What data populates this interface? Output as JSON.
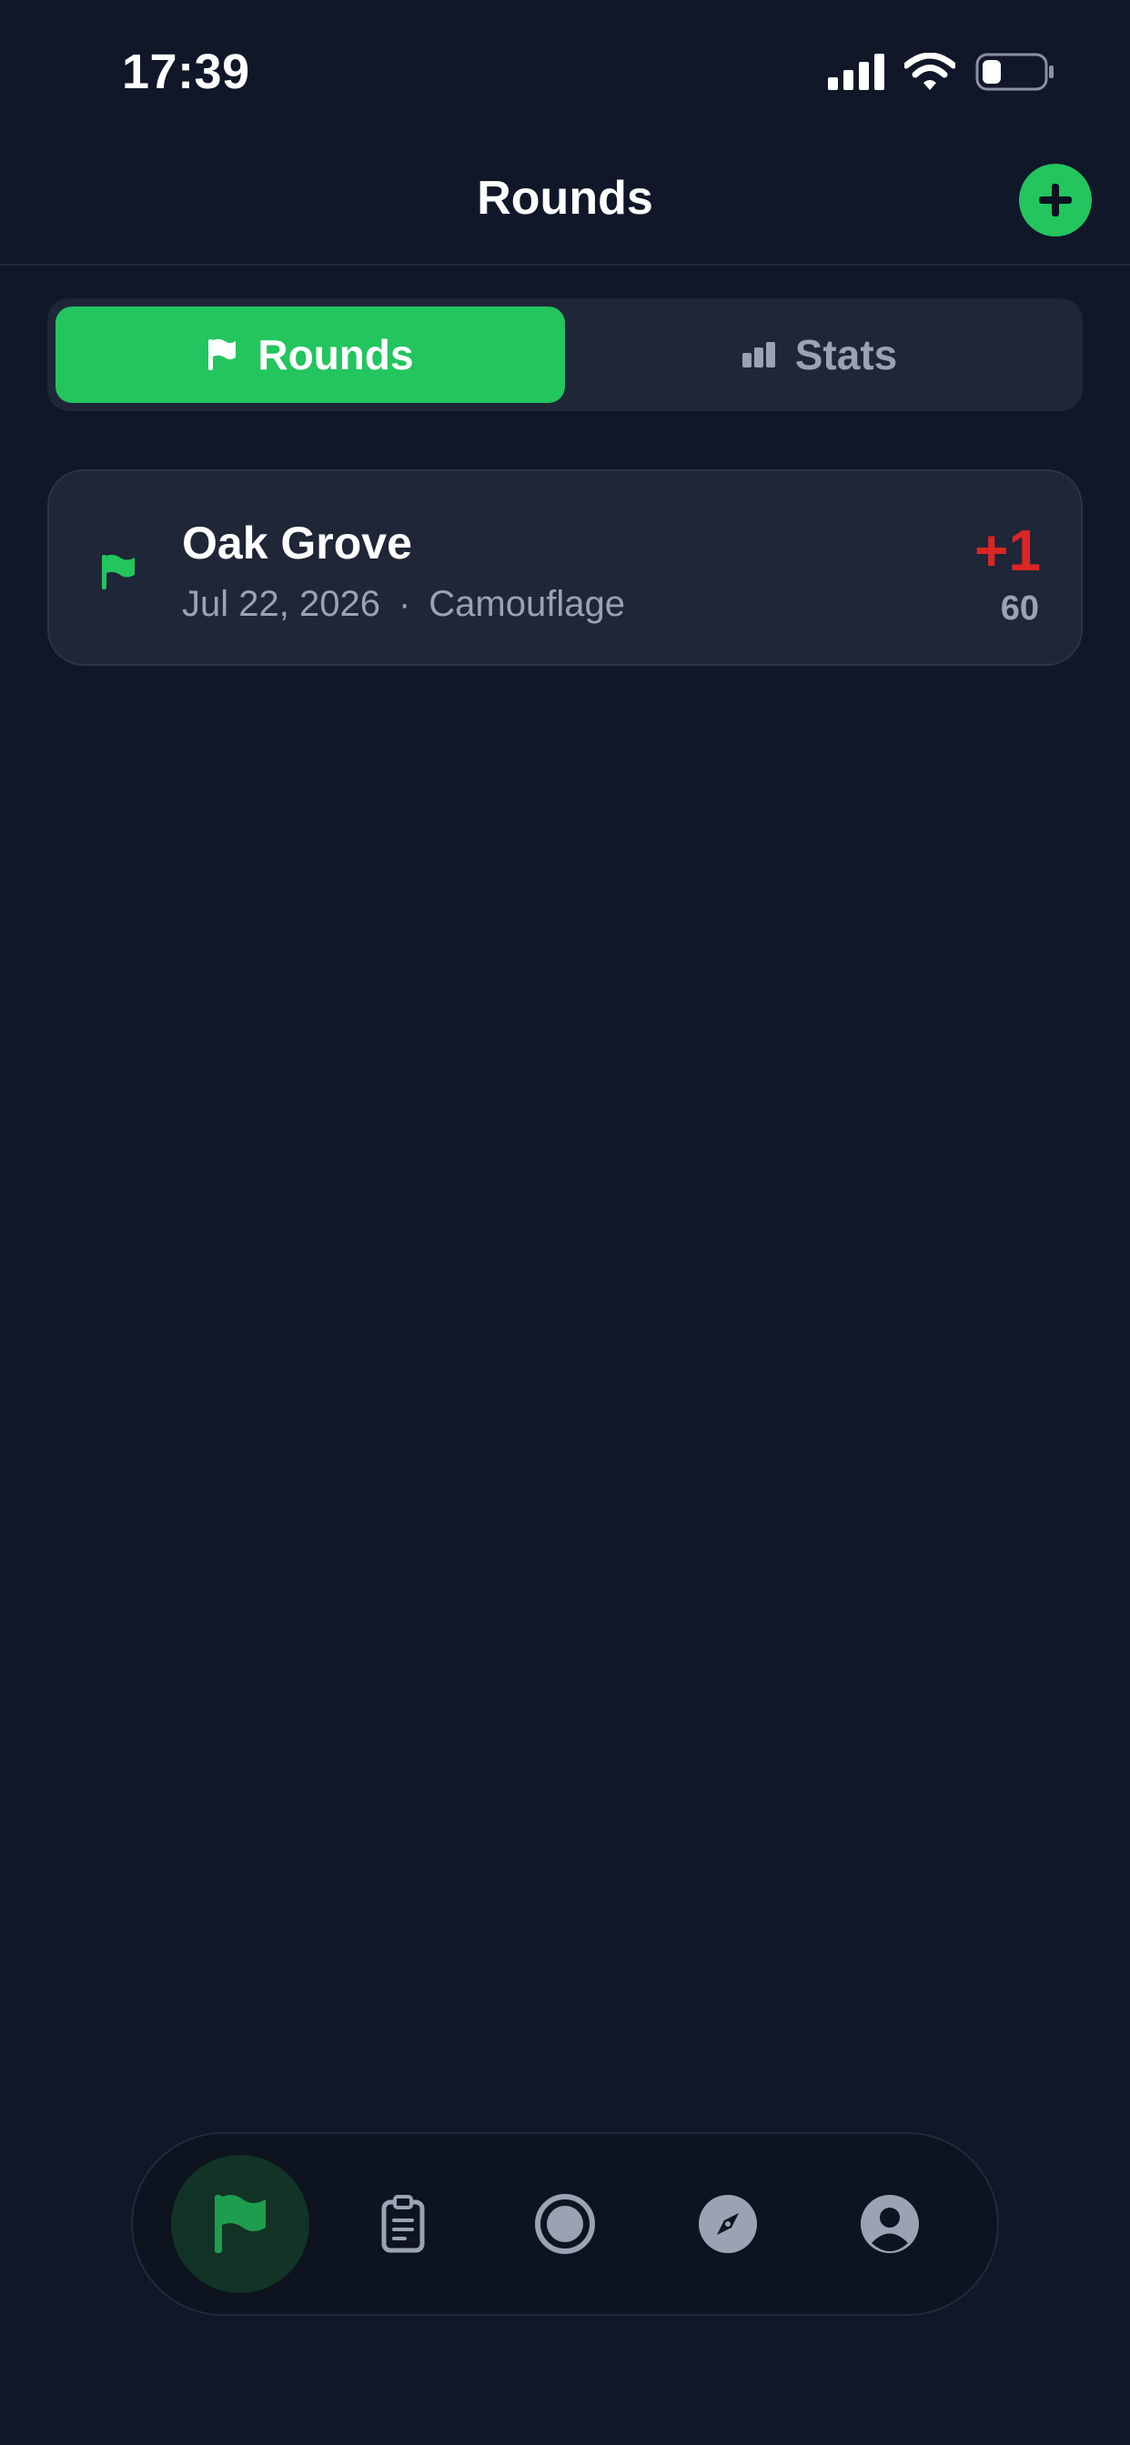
{
  "status_bar": {
    "time": "17:39"
  },
  "header": {
    "title": "Rounds"
  },
  "segments": [
    {
      "label": "Rounds",
      "icon": "flag-icon",
      "active": true
    },
    {
      "label": "Stats",
      "icon": "bar-chart-icon",
      "active": false
    }
  ],
  "rounds": [
    {
      "course": "Oak Grove",
      "date": "Jul 22, 2026",
      "separator": "·",
      "tee": "Camouflage",
      "score_to_par": "+1",
      "strokes": "60"
    }
  ],
  "tabbar": {
    "items": [
      {
        "icon": "flag-icon",
        "active": true
      },
      {
        "icon": "clipboard-icon",
        "active": false
      },
      {
        "icon": "record-icon",
        "active": false
      },
      {
        "icon": "compass-icon",
        "active": false
      },
      {
        "icon": "profile-icon",
        "active": false
      }
    ]
  },
  "colors": {
    "background": "#101729",
    "accent": "#22c55e",
    "card": "#1e2637",
    "over_par": "#dc2626",
    "muted_text": "#9aa3b2"
  }
}
